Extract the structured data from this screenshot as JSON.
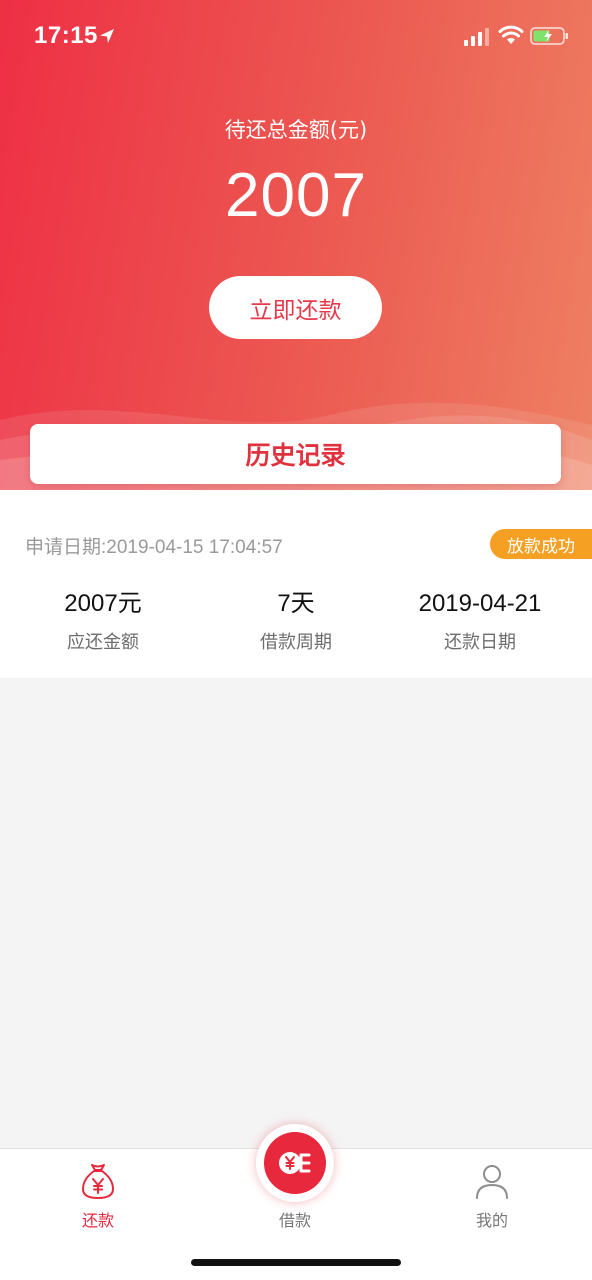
{
  "status_bar": {
    "time": "17:15",
    "icons": [
      "location-arrow-icon",
      "signal-icon",
      "wifi-icon",
      "battery-charging-icon"
    ]
  },
  "summary": {
    "label": "待还总金额(元)",
    "amount": "2007",
    "repay_button_label": "立即还款"
  },
  "history_tab": {
    "label": "历史记录"
  },
  "record": {
    "apply_date_label": "申请日期:",
    "apply_date_value": "2019-04-15 17:04:57",
    "status": "放款成功",
    "stats": [
      {
        "value": "2007元",
        "label": "应还金额"
      },
      {
        "value": "7天",
        "label": "借款周期"
      },
      {
        "value": "2019-04-21",
        "label": "还款日期"
      }
    ]
  },
  "tabbar": {
    "items": [
      {
        "label": "还款",
        "icon": "money-bag-icon",
        "active": true
      },
      {
        "label": "借款",
        "icon": "coin-icon",
        "active": false
      },
      {
        "label": "我的",
        "icon": "user-icon",
        "active": false
      }
    ]
  },
  "colors": {
    "accent": "#e8283c",
    "badge": "#f5a023",
    "gradient_start": "#ee2f45",
    "gradient_end": "#ee8062"
  }
}
